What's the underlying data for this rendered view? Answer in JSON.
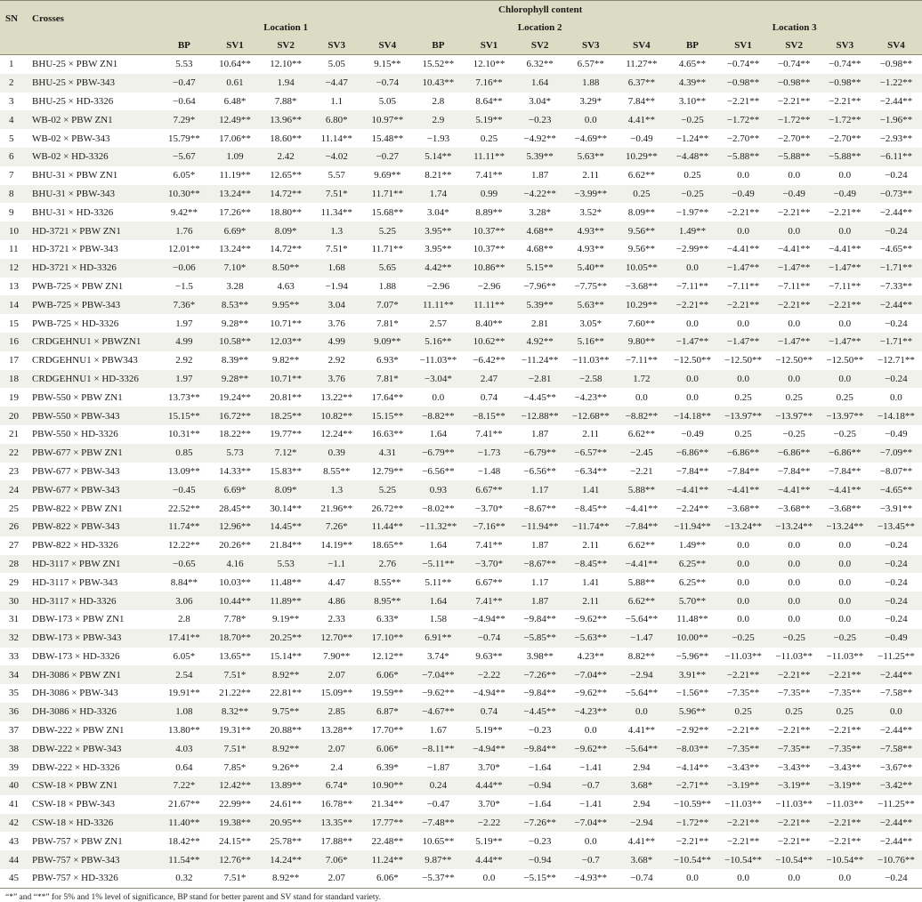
{
  "header": {
    "title": "Chlorophyll content",
    "sn": "SN",
    "crosses": "Crosses",
    "locations": [
      "Location 1",
      "Location 2",
      "Location 3"
    ],
    "columns": [
      "BP",
      "SV1",
      "SV2",
      "SV3",
      "SV4"
    ]
  },
  "rows": [
    [
      "1",
      "BHU-25 × PBW ZN1",
      "5.53",
      "10.64**",
      "12.10**",
      "5.05",
      "9.15**",
      "15.52**",
      "12.10**",
      "6.32**",
      "6.57**",
      "11.27**",
      "4.65**",
      "−0.74**",
      "−0.74**",
      "−0.74**",
      "−0.98**"
    ],
    [
      "2",
      "BHU-25 × PBW-343",
      "−0.47",
      "0.61",
      "1.94",
      "−4.47",
      "−0.74",
      "10.43**",
      "7.16**",
      "1.64",
      "1.88",
      "6.37**",
      "4.39**",
      "−0.98**",
      "−0.98**",
      "−0.98**",
      "−1.22**"
    ],
    [
      "3",
      "BHU-25 × HD-3326",
      "−0.64",
      "6.48*",
      "7.88*",
      "1.1",
      "5.05",
      "2.8",
      "8.64**",
      "3.04*",
      "3.29*",
      "7.84**",
      "3.10**",
      "−2.21**",
      "−2.21**",
      "−2.21**",
      "−2.44**"
    ],
    [
      "4",
      "WB-02 × PBW ZN1",
      "7.29*",
      "12.49**",
      "13.96**",
      "6.80*",
      "10.97**",
      "2.9",
      "5.19**",
      "−0.23",
      "0.0",
      "4.41**",
      "−0.25",
      "−1.72**",
      "−1.72**",
      "−1.72**",
      "−1.96**"
    ],
    [
      "5",
      "WB-02 × PBW-343",
      "15.79**",
      "17.06**",
      "18.60**",
      "11.14**",
      "15.48**",
      "−1.93",
      "0.25",
      "−4.92**",
      "−4.69**",
      "−0.49",
      "−1.24**",
      "−2.70**",
      "−2.70**",
      "−2.70**",
      "−2.93**"
    ],
    [
      "6",
      "WB-02 × HD-3326",
      "−5.67",
      "1.09",
      "2.42",
      "−4.02",
      "−0.27",
      "5.14**",
      "11.11**",
      "5.39**",
      "5.63**",
      "10.29**",
      "−4.48**",
      "−5.88**",
      "−5.88**",
      "−5.88**",
      "−6.11**"
    ],
    [
      "7",
      "BHU-31 × PBW ZN1",
      "6.05*",
      "11.19**",
      "12.65**",
      "5.57",
      "9.69**",
      "8.21**",
      "7.41**",
      "1.87",
      "2.11",
      "6.62**",
      "0.25",
      "0.0",
      "0.0",
      "0.0",
      "−0.24"
    ],
    [
      "8",
      "BHU-31 × PBW-343",
      "10.30**",
      "13.24**",
      "14.72**",
      "7.51*",
      "11.71**",
      "1.74",
      "0.99",
      "−4.22**",
      "−3.99**",
      "0.25",
      "−0.25",
      "−0.49",
      "−0.49",
      "−0.49",
      "−0.73**"
    ],
    [
      "9",
      "BHU-31 × HD-3326",
      "9.42**",
      "17.26**",
      "18.80**",
      "11.34**",
      "15.68**",
      "3.04*",
      "8.89**",
      "3.28*",
      "3.52*",
      "8.09**",
      "−1.97**",
      "−2.21**",
      "−2.21**",
      "−2.21**",
      "−2.44**"
    ],
    [
      "10",
      "HD-3721 × PBW ZN1",
      "1.76",
      "6.69*",
      "8.09*",
      "1.3",
      "5.25",
      "3.95**",
      "10.37**",
      "4.68**",
      "4.93**",
      "9.56**",
      "1.49**",
      "0.0",
      "0.0",
      "0.0",
      "−0.24"
    ],
    [
      "11",
      "HD-3721 × PBW-343",
      "12.01**",
      "13.24**",
      "14.72**",
      "7.51*",
      "11.71**",
      "3.95**",
      "10.37**",
      "4.68**",
      "4.93**",
      "9.56**",
      "−2.99**",
      "−4.41**",
      "−4.41**",
      "−4.41**",
      "−4.65**"
    ],
    [
      "12",
      "HD-3721 × HD-3326",
      "−0.06",
      "7.10*",
      "8.50**",
      "1.68",
      "5.65",
      "4.42**",
      "10.86**",
      "5.15**",
      "5.40**",
      "10.05**",
      "0.0",
      "−1.47**",
      "−1.47**",
      "−1.47**",
      "−1.71**"
    ],
    [
      "13",
      "PWB-725 × PBW ZN1",
      "−1.5",
      "3.28",
      "4.63",
      "−1.94",
      "1.88",
      "−2.96",
      "−2.96",
      "−7.96**",
      "−7.75**",
      "−3.68**",
      "−7.11**",
      "−7.11**",
      "−7.11**",
      "−7.11**",
      "−7.33**"
    ],
    [
      "14",
      "PWB-725 × PBW-343",
      "7.36*",
      "8.53**",
      "9.95**",
      "3.04",
      "7.07*",
      "11.11**",
      "11.11**",
      "5.39**",
      "5.63**",
      "10.29**",
      "−2.21**",
      "−2.21**",
      "−2.21**",
      "−2.21**",
      "−2.44**"
    ],
    [
      "15",
      "PWB-725 × HD-3326",
      "1.97",
      "9.28**",
      "10.71**",
      "3.76",
      "7.81*",
      "2.57",
      "8.40**",
      "2.81",
      "3.05*",
      "7.60**",
      "0.0",
      "0.0",
      "0.0",
      "0.0",
      "−0.24"
    ],
    [
      "16",
      "CRDGEHNU1 × PBWZN1",
      "4.99",
      "10.58**",
      "12.03**",
      "4.99",
      "9.09**",
      "5.16**",
      "10.62**",
      "4.92**",
      "5.16**",
      "9.80**",
      "−1.47**",
      "−1.47**",
      "−1.47**",
      "−1.47**",
      "−1.71**"
    ],
    [
      "17",
      "CRDGEHNU1 × PBW343",
      "2.92",
      "8.39**",
      "9.82**",
      "2.92",
      "6.93*",
      "−11.03**",
      "−6.42**",
      "−11.24**",
      "−11.03**",
      "−7.11**",
      "−12.50**",
      "−12.50**",
      "−12.50**",
      "−12.50**",
      "−12.71**"
    ],
    [
      "18",
      "CRDGEHNU1 × HD-3326",
      "1.97",
      "9.28**",
      "10.71**",
      "3.76",
      "7.81*",
      "−3.04*",
      "2.47",
      "−2.81",
      "−2.58",
      "1.72",
      "0.0",
      "0.0",
      "0.0",
      "0.0",
      "−0.24"
    ],
    [
      "19",
      "PBW-550 × PBW ZN1",
      "13.73**",
      "19.24**",
      "20.81**",
      "13.22**",
      "17.64**",
      "0.0",
      "0.74",
      "−4.45**",
      "−4.23**",
      "0.0",
      "0.0",
      "0.25",
      "0.25",
      "0.25",
      "0.0"
    ],
    [
      "20",
      "PBW-550 × PBW-343",
      "15.15**",
      "16.72**",
      "18.25**",
      "10.82**",
      "15.15**",
      "−8.82**",
      "−8.15**",
      "−12.88**",
      "−12.68**",
      "−8.82**",
      "−14.18**",
      "−13.97**",
      "−13.97**",
      "−13.97**",
      "−14.18**"
    ],
    [
      "21",
      "PBW-550 × HD-3326",
      "10.31**",
      "18.22**",
      "19.77**",
      "12.24**",
      "16.63**",
      "1.64",
      "7.41**",
      "1.87",
      "2.11",
      "6.62**",
      "−0.49",
      "0.25",
      "−0.25",
      "−0.25",
      "−0.49"
    ],
    [
      "22",
      "PBW-677 × PBW ZN1",
      "0.85",
      "5.73",
      "7.12*",
      "0.39",
      "4.31",
      "−6.79**",
      "−1.73",
      "−6.79**",
      "−6.57**",
      "−2.45",
      "−6.86**",
      "−6.86**",
      "−6.86**",
      "−6.86**",
      "−7.09**"
    ],
    [
      "23",
      "PBW-677 × PBW-343",
      "13.09**",
      "14.33**",
      "15.83**",
      "8.55**",
      "12.79**",
      "−6.56**",
      "−1.48",
      "−6.56**",
      "−6.34**",
      "−2.21",
      "−7.84**",
      "−7.84**",
      "−7.84**",
      "−7.84**",
      "−8.07**"
    ],
    [
      "24",
      "PBW-677 × PBW-343",
      "−0.45",
      "6.69*",
      "8.09*",
      "1.3",
      "5.25",
      "0.93",
      "6.67**",
      "1.17",
      "1.41",
      "5.88**",
      "−4.41**",
      "−4.41**",
      "−4.41**",
      "−4.41**",
      "−4.65**"
    ],
    [
      "25",
      "PBW-822 × PBW ZN1",
      "22.52**",
      "28.45**",
      "30.14**",
      "21.96**",
      "26.72**",
      "−8.02**",
      "−3.70*",
      "−8.67**",
      "−8.45**",
      "−4.41**",
      "−2.24**",
      "−3.68**",
      "−3.68**",
      "−3.68**",
      "−3.91**"
    ],
    [
      "26",
      "PBW-822 × PBW-343",
      "11.74**",
      "12.96**",
      "14.45**",
      "7.26*",
      "11.44**",
      "−11.32**",
      "−7.16**",
      "−11.94**",
      "−11.74**",
      "−7.84**",
      "−11.94**",
      "−13.24**",
      "−13.24**",
      "−13.24**",
      "−13.45**"
    ],
    [
      "27",
      "PBW-822 × HD-3326",
      "12.22**",
      "20.26**",
      "21.84**",
      "14.19**",
      "18.65**",
      "1.64",
      "7.41**",
      "1.87",
      "2.11",
      "6.62**",
      "1.49**",
      "0.0",
      "0.0",
      "0.0",
      "−0.24"
    ],
    [
      "28",
      "HD-3117 × PBW ZN1",
      "−0.65",
      "4.16",
      "5.53",
      "−1.1",
      "2.76",
      "−5.11**",
      "−3.70*",
      "−8.67**",
      "−8.45**",
      "−4.41**",
      "6.25**",
      "0.0",
      "0.0",
      "0.0",
      "−0.24"
    ],
    [
      "29",
      "HD-3117 × PBW-343",
      "8.84**",
      "10.03**",
      "11.48**",
      "4.47",
      "8.55**",
      "5.11**",
      "6.67**",
      "1.17",
      "1.41",
      "5.88**",
      "6.25**",
      "0.0",
      "0.0",
      "0.0",
      "−0.24"
    ],
    [
      "30",
      "HD-3117 × HD-3326",
      "3.06",
      "10.44**",
      "11.89**",
      "4.86",
      "8.95**",
      "1.64",
      "7.41**",
      "1.87",
      "2.11",
      "6.62**",
      "5.70**",
      "0.0",
      "0.0",
      "0.0",
      "−0.24"
    ],
    [
      "31",
      "DBW-173 × PBW ZN1",
      "2.8",
      "7.78*",
      "9.19**",
      "2.33",
      "6.33*",
      "1.58",
      "−4.94**",
      "−9.84**",
      "−9.62**",
      "−5.64**",
      "11.48**",
      "0.0",
      "0.0",
      "0.0",
      "−0.24"
    ],
    [
      "32",
      "DBW-173 × PBW-343",
      "17.41**",
      "18.70**",
      "20.25**",
      "12.70**",
      "17.10**",
      "6.91**",
      "−0.74",
      "−5.85**",
      "−5.63**",
      "−1.47",
      "10.00**",
      "−0.25",
      "−0.25",
      "−0.25",
      "−0.49"
    ],
    [
      "33",
      "DBW-173 × HD-3326",
      "6.05*",
      "13.65**",
      "15.14**",
      "7.90**",
      "12.12**",
      "3.74*",
      "9.63**",
      "3.98**",
      "4.23**",
      "8.82**",
      "−5.96**",
      "−11.03**",
      "−11.03**",
      "−11.03**",
      "−11.25**"
    ],
    [
      "34",
      "DH-3086 × PBW ZN1",
      "2.54",
      "7.51*",
      "8.92**",
      "2.07",
      "6.06*",
      "−7.04**",
      "−2.22",
      "−7.26**",
      "−7.04**",
      "−2.94",
      "3.91**",
      "−2.21**",
      "−2.21**",
      "−2.21**",
      "−2.44**"
    ],
    [
      "35",
      "DH-3086 × PBW-343",
      "19.91**",
      "21.22**",
      "22.81**",
      "15.09**",
      "19.59**",
      "−9.62**",
      "−4.94**",
      "−9.84**",
      "−9.62**",
      "−5.64**",
      "−1.56**",
      "−7.35**",
      "−7.35**",
      "−7.35**",
      "−7.58**"
    ],
    [
      "36",
      "DH-3086 × HD-3326",
      "1.08",
      "8.32**",
      "9.75**",
      "2.85",
      "6.87*",
      "−4.67**",
      "0.74",
      "−4.45**",
      "−4.23**",
      "0.0",
      "5.96**",
      "0.25",
      "0.25",
      "0.25",
      "0.0"
    ],
    [
      "37",
      "DBW-222 × PBW ZN1",
      "13.80**",
      "19.31**",
      "20.88**",
      "13.28**",
      "17.70**",
      "1.67",
      "5.19**",
      "−0.23",
      "0.0",
      "4.41**",
      "−2.92**",
      "−2.21**",
      "−2.21**",
      "−2.21**",
      "−2.44**"
    ],
    [
      "38",
      "DBW-222 × PBW-343",
      "4.03",
      "7.51*",
      "8.92**",
      "2.07",
      "6.06*",
      "−8.11**",
      "−4.94**",
      "−9.84**",
      "−9.62**",
      "−5.64**",
      "−8.03**",
      "−7.35**",
      "−7.35**",
      "−7.35**",
      "−7.58**"
    ],
    [
      "39",
      "DBW-222 × HD-3326",
      "0.64",
      "7.85*",
      "9.26**",
      "2.4",
      "6.39*",
      "−1.87",
      "3.70*",
      "−1.64",
      "−1.41",
      "2.94",
      "−4.14**",
      "−3.43**",
      "−3.43**",
      "−3.43**",
      "−3.67**"
    ],
    [
      "40",
      "CSW-18 × PBW ZN1",
      "7.22*",
      "12.42**",
      "13.89**",
      "6.74*",
      "10.90**",
      "0.24",
      "4.44**",
      "−0.94",
      "−0.7",
      "3.68*",
      "−2.71**",
      "−3.19**",
      "−3.19**",
      "−3.19**",
      "−3.42**"
    ],
    [
      "41",
      "CSW-18 × PBW-343",
      "21.67**",
      "22.99**",
      "24.61**",
      "16.78**",
      "21.34**",
      "−0.47",
      "3.70*",
      "−1.64",
      "−1.41",
      "2.94",
      "−10.59**",
      "−11.03**",
      "−11.03**",
      "−11.03**",
      "−11.25**"
    ],
    [
      "42",
      "CSW-18 × HD-3326",
      "11.40**",
      "19.38**",
      "20.95**",
      "13.35**",
      "17.77**",
      "−7.48**",
      "−2.22",
      "−7.26**",
      "−7.04**",
      "−2.94",
      "−1.72**",
      "−2.21**",
      "−2.21**",
      "−2.21**",
      "−2.44**"
    ],
    [
      "43",
      "PBW-757 × PBW ZN1",
      "18.42**",
      "24.15**",
      "25.78**",
      "17.88**",
      "22.48**",
      "10.65**",
      "5.19**",
      "−0.23",
      "0.0",
      "4.41**",
      "−2.21**",
      "−2.21**",
      "−2.21**",
      "−2.21**",
      "−2.44**"
    ],
    [
      "44",
      "PBW-757 × PBW-343",
      "11.54**",
      "12.76**",
      "14.24**",
      "7.06*",
      "11.24**",
      "9.87**",
      "4.44**",
      "−0.94",
      "−0.7",
      "3.68*",
      "−10.54**",
      "−10.54**",
      "−10.54**",
      "−10.54**",
      "−10.76**"
    ],
    [
      "45",
      "PBW-757 × HD-3326",
      "0.32",
      "7.51*",
      "8.92**",
      "2.07",
      "6.06*",
      "−5.37**",
      "0.0",
      "−5.15**",
      "−4.93**",
      "−0.74",
      "0.0",
      "0.0",
      "0.0",
      "0.0",
      "−0.24"
    ]
  ],
  "footnote": "“*” and “**” for 5% and 1% level of significance, BP stand for better parent and SV stand for standard variety."
}
